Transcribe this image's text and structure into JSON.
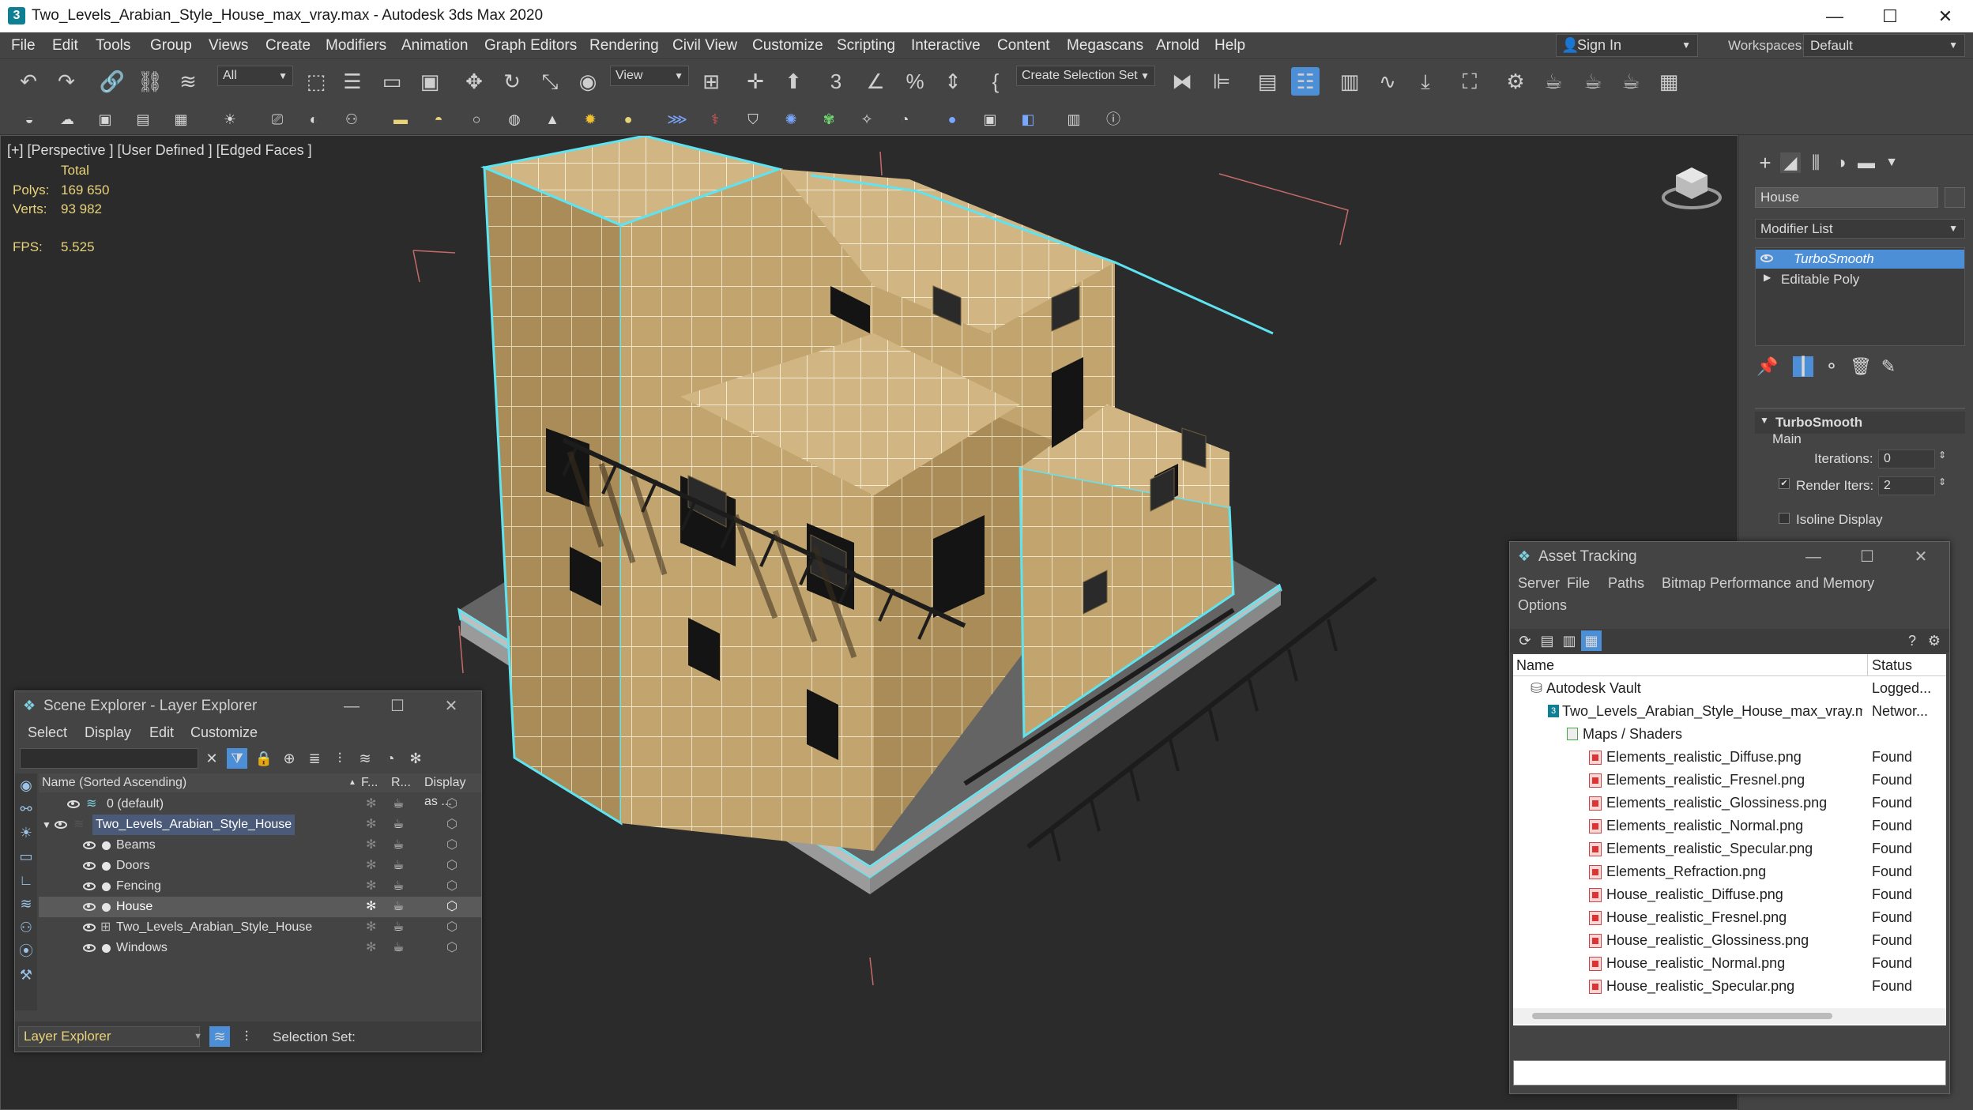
{
  "window": {
    "title": "Two_Levels_Arabian_Style_House_max_vray.max - Autodesk 3ds Max 2020",
    "app_icon": "3"
  },
  "menu": [
    "File",
    "Edit",
    "Tools",
    "Group",
    "Views",
    "Create",
    "Modifiers",
    "Animation",
    "Graph Editors",
    "Rendering",
    "Civil View",
    "Customize",
    "Scripting",
    "Interactive",
    "Content",
    "Megascans",
    "Arnold",
    "Help"
  ],
  "account": {
    "sign_in": "Sign In",
    "workspaces_label": "Workspaces:",
    "workspace": "Default"
  },
  "toolbar": {
    "filter": "All",
    "ref_coord": "View",
    "selection_set": "Create Selection Set"
  },
  "viewport": {
    "label": "[+] [Perspective ] [User Defined ] [Edged Faces ]",
    "stats": {
      "total_label": "Total",
      "polys_label": "Polys:",
      "polys": "169 650",
      "verts_label": "Verts:",
      "verts": "93 982",
      "fps_label": "FPS:",
      "fps": "5.525"
    }
  },
  "command_panel": {
    "object_name": "House",
    "modifier_list": "Modifier List",
    "stack": [
      "TurboSmooth",
      "Editable Poly"
    ],
    "rollout": "TurboSmooth",
    "section": "Main",
    "iterations_label": "Iterations:",
    "iterations": "0",
    "render_iters_label": "Render Iters:",
    "render_iters": "2",
    "isoline": "Isoline Display"
  },
  "scene_explorer": {
    "title": "Scene Explorer - Layer Explorer",
    "menu": [
      "Select",
      "Display",
      "Edit",
      "Customize"
    ],
    "columns": [
      "Name (Sorted Ascending)",
      "F...",
      "R...",
      "Display as ..."
    ],
    "rows": [
      {
        "name": "0 (default)",
        "level": 0
      },
      {
        "name": "Two_Levels_Arabian_Style_House",
        "level": 0
      },
      {
        "name": "Beams",
        "level": 1
      },
      {
        "name": "Doors",
        "level": 1
      },
      {
        "name": "Fencing",
        "level": 1
      },
      {
        "name": "House",
        "level": 1
      },
      {
        "name": "Two_Levels_Arabian_Style_House",
        "level": 1
      },
      {
        "name": "Windows",
        "level": 1
      }
    ],
    "footer_mode": "Layer Explorer",
    "selection_set_label": "Selection Set:"
  },
  "asset_tracking": {
    "title": "Asset Tracking",
    "menu": [
      "Server",
      "File",
      "Paths",
      "Bitmap Performance and Memory"
    ],
    "menu2": "Options",
    "columns": [
      "Name",
      "Status"
    ],
    "rows": [
      {
        "name": "Autodesk Vault",
        "status": "Logged..."
      },
      {
        "name": "Two_Levels_Arabian_Style_House_max_vray.max",
        "status": "Networ..."
      },
      {
        "name": "Maps / Shaders",
        "status": ""
      },
      {
        "name": "Elements_realistic_Diffuse.png",
        "status": "Found"
      },
      {
        "name": "Elements_realistic_Fresnel.png",
        "status": "Found"
      },
      {
        "name": "Elements_realistic_Glossiness.png",
        "status": "Found"
      },
      {
        "name": "Elements_realistic_Normal.png",
        "status": "Found"
      },
      {
        "name": "Elements_realistic_Specular.png",
        "status": "Found"
      },
      {
        "name": "Elements_Refraction.png",
        "status": "Found"
      },
      {
        "name": "House_realistic_Diffuse.png",
        "status": "Found"
      },
      {
        "name": "House_realistic_Fresnel.png",
        "status": "Found"
      },
      {
        "name": "House_realistic_Glossiness.png",
        "status": "Found"
      },
      {
        "name": "House_realistic_Normal.png",
        "status": "Found"
      },
      {
        "name": "House_realistic_Specular.png",
        "status": "Found"
      }
    ]
  },
  "colors": {
    "accent": "#4d8fd6",
    "selection_outline": "#5fe3f0",
    "stat_text": "#e8d27a",
    "house": "#c2a46e"
  }
}
